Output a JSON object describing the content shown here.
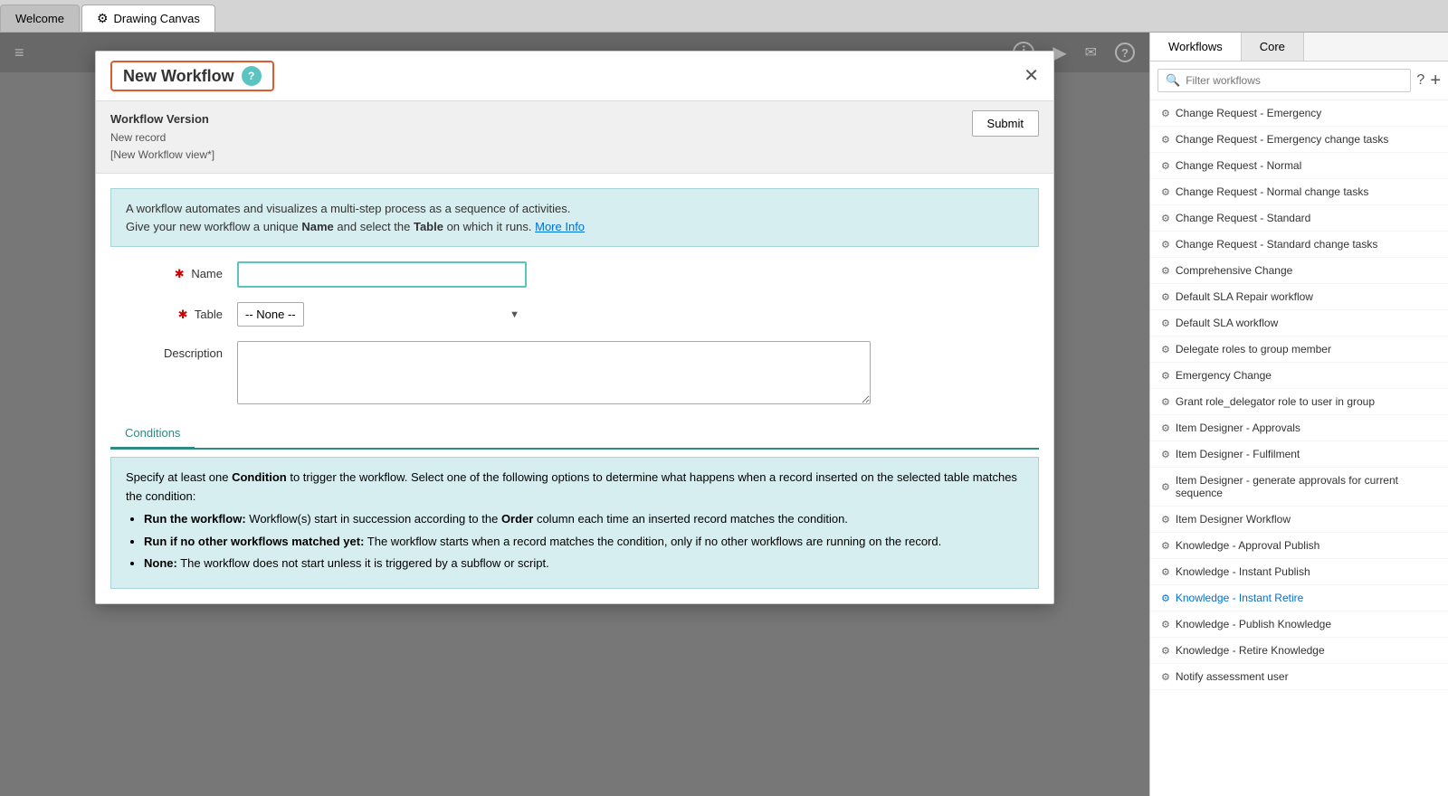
{
  "tabs": [
    {
      "id": "welcome",
      "label": "Welcome",
      "icon": "",
      "active": false
    },
    {
      "id": "drawing-canvas",
      "label": "Drawing Canvas",
      "icon": "⚙",
      "active": true
    }
  ],
  "toolbar": {
    "hamburger": "≡",
    "info_icon": "ℹ",
    "play_icon": "▶",
    "mail_icon": "✉",
    "help_icon": "?"
  },
  "modal": {
    "title": "New Workflow",
    "help_label": "?",
    "close_label": "✕",
    "version_title": "Workflow Version",
    "version_sub1": "New record",
    "version_sub2": "[New Workflow view*]",
    "submit_label": "Submit",
    "info_text_part1": "A workflow automates and visualizes a multi-step process as a sequence of activities.",
    "info_text_part2": "Give your new workflow a unique ",
    "info_bold_name": "Name",
    "info_text_part3": " and select the ",
    "info_bold_table": "Table",
    "info_text_part4": " on which it runs. ",
    "info_link": "More Info",
    "name_label": "Name",
    "name_required": true,
    "name_value": "",
    "table_label": "Table",
    "table_required": true,
    "table_value": "-- None --",
    "table_options": [
      "-- None --"
    ],
    "description_label": "Description",
    "description_value": "",
    "conditions_tab": "Conditions",
    "conditions_info": "Specify at least one ",
    "conditions_bold": "Condition",
    "conditions_text": " to trigger the workflow. Select one of the following options to determine what happens when a record inserted on the selected table matches the condition:",
    "conditions_bullets": [
      {
        "bold": "Run the workflow:",
        "text": " Workflow(s) start in succession according to the ",
        "bold2": "Order",
        "text2": " column each time an inserted record matches the condition."
      },
      {
        "bold": "Run if no other workflows matched yet:",
        "text": " The workflow starts when a record matches the condition, only if no other workflows are running on the record."
      },
      {
        "bold": "None:",
        "text": " The workflow does not start unless it is triggered by a subflow or script."
      }
    ]
  },
  "right_panel": {
    "tabs": [
      {
        "id": "workflows",
        "label": "Workflows",
        "active": true
      },
      {
        "id": "core",
        "label": "Core",
        "active": false
      }
    ],
    "search_placeholder": "Filter workflows",
    "help_label": "?",
    "add_label": "+",
    "workflows": [
      {
        "label": "Change Request - Emergency",
        "active": false
      },
      {
        "label": "Change Request - Emergency change tasks",
        "active": false
      },
      {
        "label": "Change Request - Normal",
        "active": false
      },
      {
        "label": "Change Request - Normal change tasks",
        "active": false
      },
      {
        "label": "Change Request - Standard",
        "active": false
      },
      {
        "label": "Change Request - Standard change tasks",
        "active": false
      },
      {
        "label": "Comprehensive Change",
        "active": false
      },
      {
        "label": "Default SLA Repair workflow",
        "active": false
      },
      {
        "label": "Default SLA workflow",
        "active": false
      },
      {
        "label": "Delegate roles to group member",
        "active": false
      },
      {
        "label": "Emergency Change",
        "active": false
      },
      {
        "label": "Grant role_delegator role to user in group",
        "active": false
      },
      {
        "label": "Item Designer - Approvals",
        "active": false
      },
      {
        "label": "Item Designer - Fulfilment",
        "active": false
      },
      {
        "label": "Item Designer - generate approvals for current sequence",
        "active": false
      },
      {
        "label": "Item Designer Workflow",
        "active": false
      },
      {
        "label": "Knowledge - Approval Publish",
        "active": false
      },
      {
        "label": "Knowledge - Instant Publish",
        "active": false
      },
      {
        "label": "Knowledge - Instant Retire",
        "active": true
      },
      {
        "label": "Knowledge - Publish Knowledge",
        "active": false
      },
      {
        "label": "Knowledge - Retire Knowledge",
        "active": false
      },
      {
        "label": "Notify assessment user",
        "active": false
      }
    ]
  }
}
